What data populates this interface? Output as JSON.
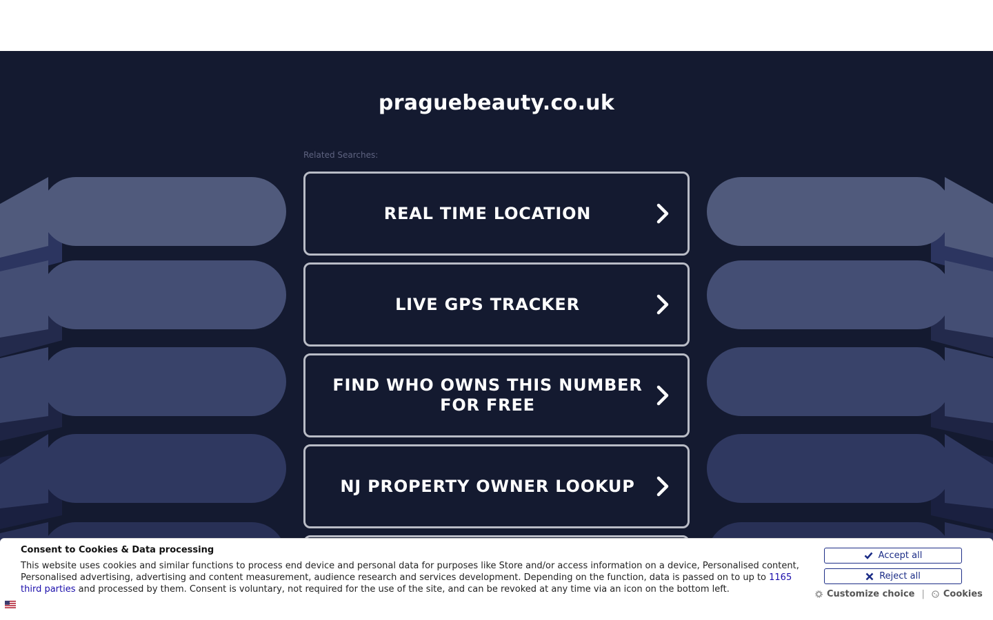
{
  "header": {
    "domain": "praguebeauty.co.uk"
  },
  "related": {
    "label": "Related Searches:"
  },
  "links": [
    {
      "label": "REAL TIME LOCATION"
    },
    {
      "label": "LIVE GPS TRACKER"
    },
    {
      "label": "FIND WHO OWNS THIS NUMBER FOR FREE"
    },
    {
      "label": "NJ PROPERTY OWNER LOOKUP"
    }
  ],
  "cookie": {
    "title": "Consent to Cookies & Data processing",
    "text_before": "This website uses cookies and similar functions to process end device and personal data for purposes like Store and/or access information on a device, Personalised content, Personalised advertising, advertising and content measurement, audience research and services development. Depending on the function, data is passed on to up to ",
    "link_text": "1165 third parties",
    "text_after": " and processed by them. Consent is voluntary, not required for the use of the site, and can be revoked at any time via an icon on the bottom left.",
    "accept_label": "Accept all",
    "reject_label": "Reject all",
    "customize_label": "Customize choice",
    "separator": "|",
    "cookies_label": "Cookies"
  },
  "colors": {
    "background": "#141a30",
    "button_border": "#b9bcc6",
    "cookie_button": "#1b2c86",
    "link": "#1a0dab"
  }
}
